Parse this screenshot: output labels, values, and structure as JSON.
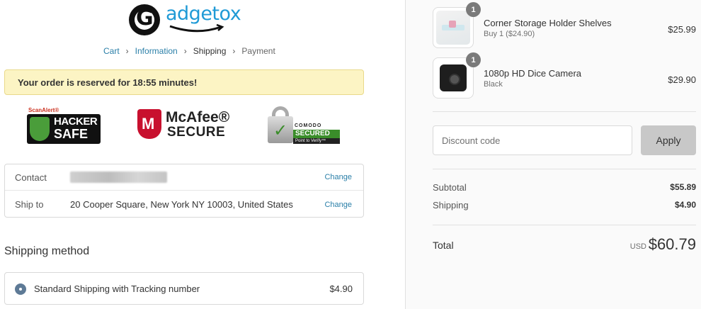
{
  "brand": {
    "logo_letter": "G",
    "logo_text": "adgetox",
    "accent": "#1f9ad6"
  },
  "breadcrumb": {
    "items": [
      "Cart",
      "Information",
      "Shipping",
      "Payment"
    ],
    "current": "Shipping"
  },
  "reservation": {
    "text": "Your order is reserved for 18:55 minutes!"
  },
  "trust_badges": {
    "hacker_safe": {
      "top": "ScanAlert®",
      "line1": "HACKER",
      "line2": "SAFE"
    },
    "mcafee": {
      "line1": "McAfee®",
      "line2": "SECURE"
    },
    "comodo": {
      "line1": "COMODO",
      "line2": "SECURED",
      "line3": "Point to Verify™"
    }
  },
  "review": {
    "contact_label": "Contact",
    "ship_to_label": "Ship to",
    "ship_to_value": "20 Cooper Square, New York NY 10003, United States",
    "change_label": "Change"
  },
  "shipping_method": {
    "title": "Shipping method",
    "option_name": "Standard Shipping with Tracking number",
    "option_price": "$4.90"
  },
  "order": {
    "items": [
      {
        "title": "Corner Storage Holder Shelves",
        "subtitle": "Buy 1 ($24.90)",
        "price": "$25.99",
        "quantity": "1"
      },
      {
        "title": "1080p HD Dice Camera",
        "subtitle": "Black",
        "price": "$29.90",
        "quantity": "1"
      }
    ],
    "discount_placeholder": "Discount code",
    "apply_label": "Apply",
    "subtotal_label": "Subtotal",
    "subtotal_value": "$55.89",
    "shipping_label": "Shipping",
    "shipping_value": "$4.90",
    "total_label": "Total",
    "currency": "USD",
    "total_value": "$60.79"
  }
}
